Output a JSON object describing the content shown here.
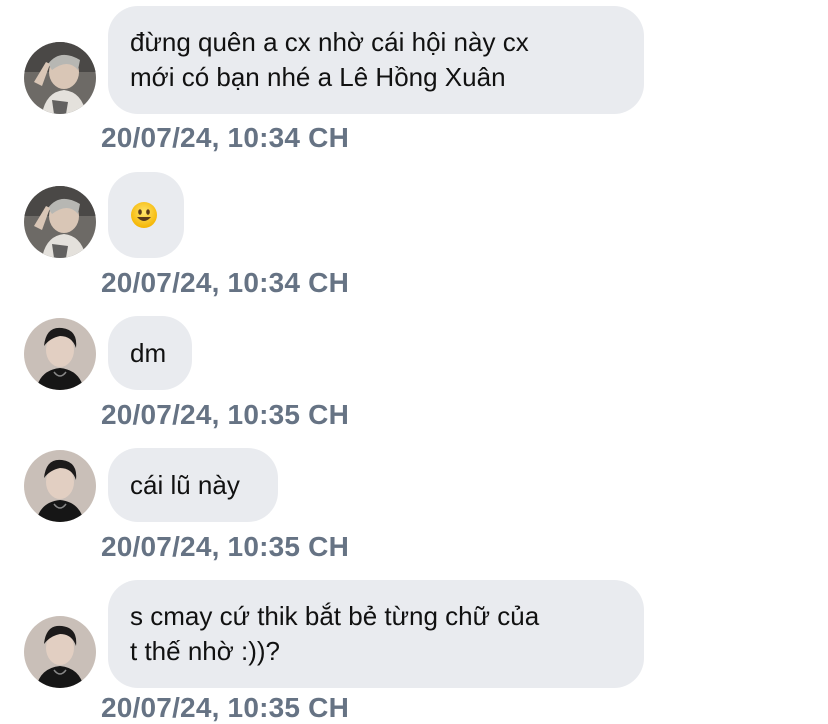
{
  "messages": [
    {
      "sender_avatar": "avatar-user-a",
      "lines": [
        "đừng quên a cx nhờ cái hội này cx",
        "mới có bạn nhé a Lê Hồng Xuân"
      ],
      "timestamp": "20/07/24, 10:34 CH"
    },
    {
      "sender_avatar": "avatar-user-a",
      "emoji": "smiley-emoji",
      "timestamp": "20/07/24, 10:34 CH"
    },
    {
      "sender_avatar": "avatar-user-b",
      "lines": [
        "dm"
      ],
      "timestamp": "20/07/24, 10:35 CH"
    },
    {
      "sender_avatar": "avatar-user-b",
      "lines": [
        "cái lũ này"
      ],
      "timestamp": "20/07/24, 10:35 CH"
    },
    {
      "sender_avatar": "avatar-user-b",
      "lines": [
        "s cmay cứ thik bắt bẻ từng chữ của",
        "t thế nhờ :))?"
      ],
      "timestamp": "20/07/24, 10:35 CH"
    }
  ],
  "colors": {
    "bubble_bg": "#e9ebef",
    "timestamp": "#667384",
    "text": "#111111"
  }
}
